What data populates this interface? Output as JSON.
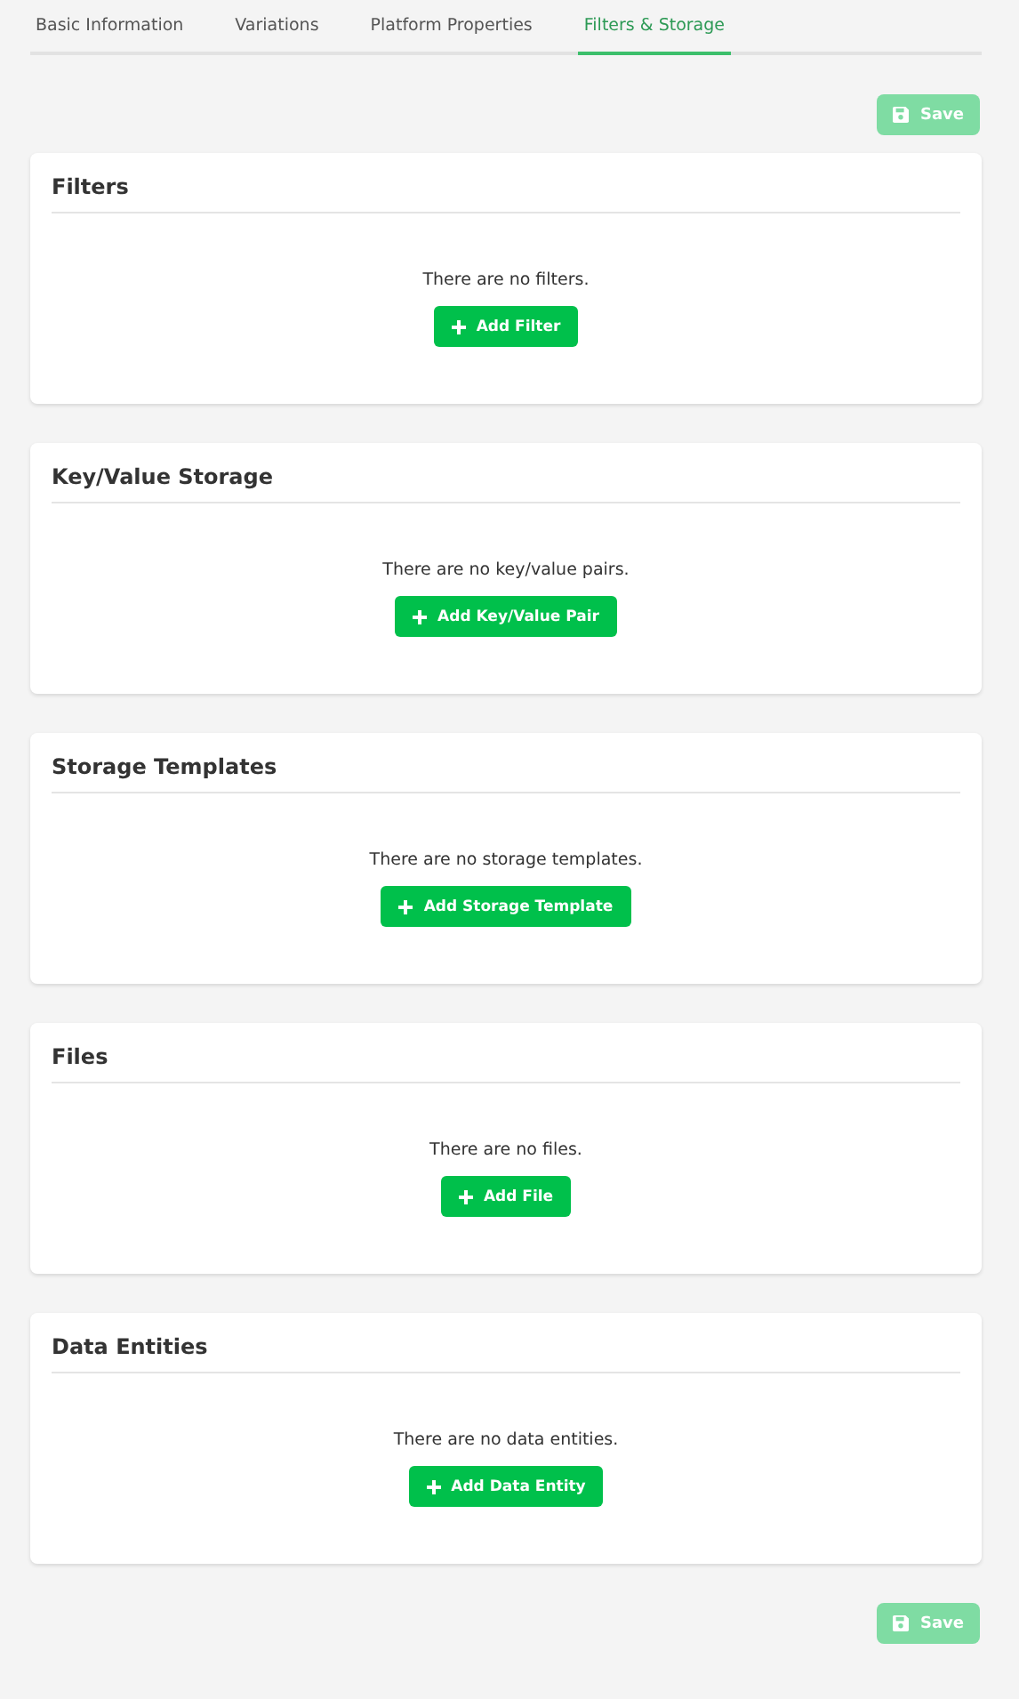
{
  "tabs": [
    {
      "label": "Basic Information",
      "selected": false
    },
    {
      "label": "Variations",
      "selected": false
    },
    {
      "label": "Platform Properties",
      "selected": false
    },
    {
      "label": "Filters & Storage",
      "selected": true
    }
  ],
  "save_top": {
    "label": "Save",
    "disabled": true
  },
  "sections": [
    {
      "title": "Filters",
      "message": "There are no filters.",
      "button": "Add Filter"
    },
    {
      "title": "Key/Value Storage",
      "message": "There are no key/value pairs.",
      "button": "Add Key/Value Pair"
    },
    {
      "title": "Storage Templates",
      "message": "There are no storage templates.",
      "button": "Add Storage Template"
    },
    {
      "title": "Files",
      "message": "There are no files.",
      "button": "Add File"
    },
    {
      "title": "Data Entities",
      "message": "There are no data entities.",
      "button": "Add Data Entity"
    }
  ],
  "save_bottom": {
    "label": "Save",
    "disabled": true
  }
}
